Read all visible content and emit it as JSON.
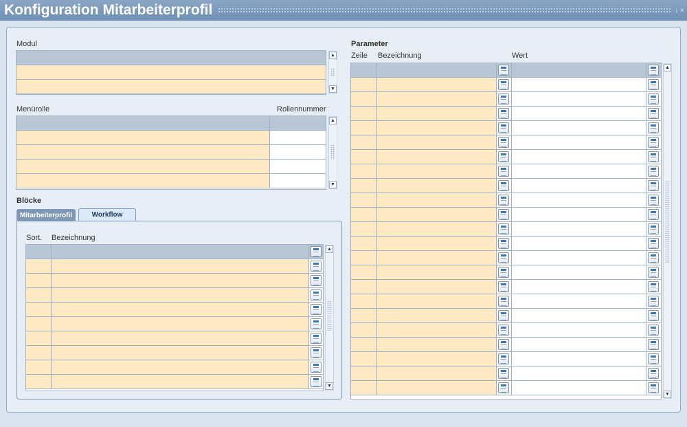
{
  "window": {
    "title": "Konfiguration Mitarbeiterprofil",
    "controls": "↓ ×"
  },
  "modul": {
    "label": "Modul"
  },
  "menurolle": {
    "label": "Menürolle",
    "rollennummer_label": "Rollennummer"
  },
  "bloecke": {
    "label": "Blöcke",
    "tabs": [
      "Mitarbeiterprofil",
      "Workflow"
    ],
    "columns": {
      "sort": "Sort.",
      "bezeichnung": "Bezeichnung"
    }
  },
  "parameter": {
    "label": "Parameter",
    "columns": {
      "zeile": "Zeile",
      "bezeichnung": "Bezeichnung",
      "wert": "Wert"
    }
  },
  "icons": {
    "lookup": "lookup-list-icon",
    "scroll_up": "arrow-up-icon",
    "scroll_down": "arrow-down-icon"
  },
  "colors": {
    "title_bar": "#7b98bb",
    "header_row": "#b9c6d6",
    "cream_cell": "#fde9c3",
    "border": "#9fb1c7"
  }
}
